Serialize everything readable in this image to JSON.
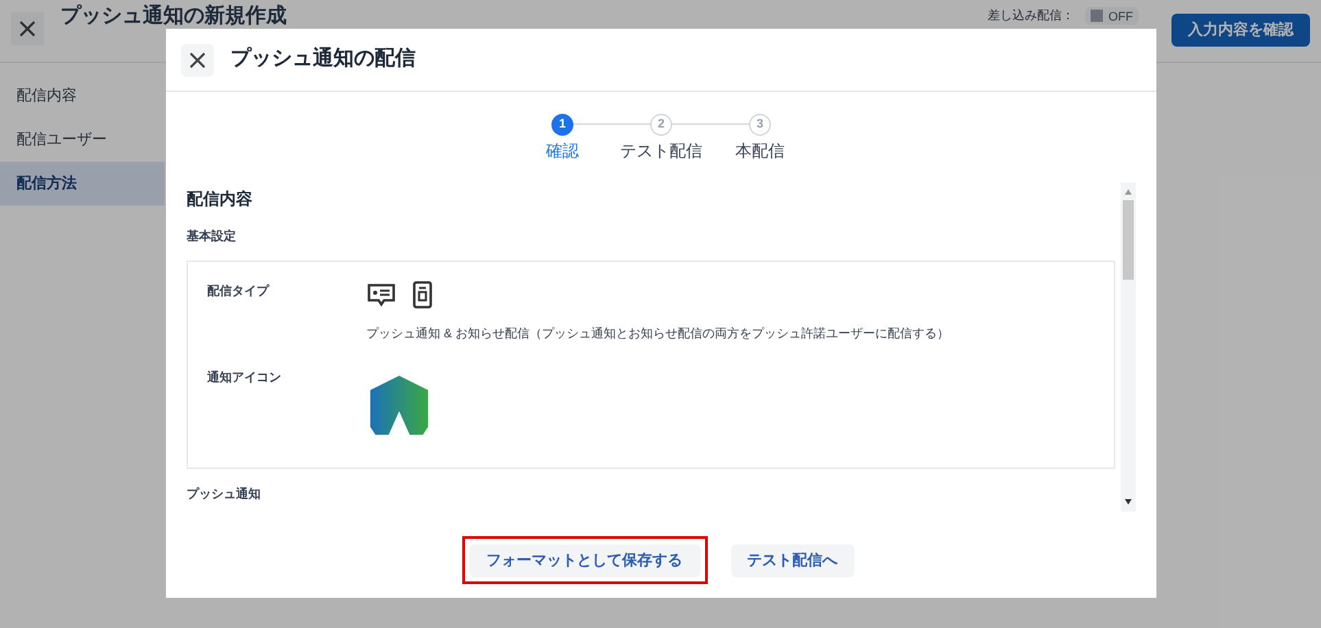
{
  "page": {
    "title": "プッシュ通知の新規作成",
    "merge_label": "差し込み配信：",
    "merge_toggle": {
      "label": "OFF",
      "on": false
    },
    "confirm_button": "入力内容を確認"
  },
  "sidebar": {
    "items": [
      {
        "label": "配信内容",
        "selected": false
      },
      {
        "label": "配信ユーザー",
        "selected": false
      },
      {
        "label": "配信方法",
        "selected": true
      }
    ]
  },
  "dialog": {
    "title": "プッシュ通知の配信",
    "steps": [
      {
        "number": "1",
        "label": "確認",
        "selected": true
      },
      {
        "number": "2",
        "label": "テスト配信",
        "selected": false
      },
      {
        "number": "3",
        "label": "本配信",
        "selected": false
      }
    ],
    "section_title": "配信内容",
    "subsection": "基本設定",
    "fields": [
      {
        "label": "配信タイプ",
        "kind": "type",
        "description": "プッシュ通知 & お知らせ配信（プッシュ通知とお知らせ配信の両方をプッシュ許諾ユーザーに配信する）"
      },
      {
        "label": "通知アイコン",
        "kind": "icon"
      }
    ],
    "next_section": "プッシュ通知",
    "buttons": [
      {
        "label": "フォーマットとして保存する",
        "highlighted": true
      },
      {
        "label": "テスト配信へ",
        "highlighted": false
      }
    ]
  }
}
